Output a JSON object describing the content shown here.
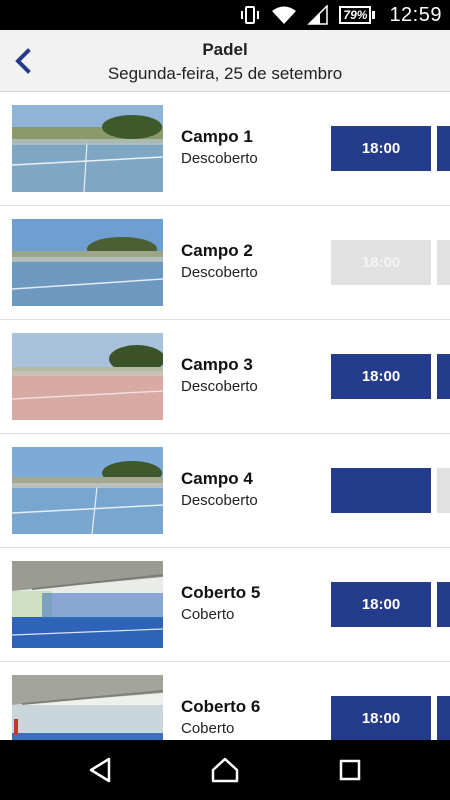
{
  "status_bar": {
    "battery": "79%",
    "time": "12:59",
    "icons": [
      "vibrate-icon",
      "wifi-icon",
      "signal-icon",
      "battery-icon"
    ]
  },
  "header": {
    "title": "Padel",
    "subtitle": "Segunda-feira, 25 de setembro"
  },
  "courts": [
    {
      "name": "Campo 1",
      "type": "Descoberto",
      "slots": [
        {
          "label": "18:00",
          "available": true
        },
        {
          "label": "",
          "available": true
        }
      ]
    },
    {
      "name": "Campo 2",
      "type": "Descoberto",
      "slots": [
        {
          "label": "18:00",
          "available": false
        },
        {
          "label": "",
          "available": false
        }
      ]
    },
    {
      "name": "Campo 3",
      "type": "Descoberto",
      "slots": [
        {
          "label": "18:00",
          "available": true
        },
        {
          "label": "",
          "available": true
        }
      ]
    },
    {
      "name": "Campo 4",
      "type": "Descoberto",
      "slots": [
        {
          "label": "",
          "available": true
        },
        {
          "label": "",
          "available": false
        }
      ]
    },
    {
      "name": "Coberto 5",
      "type": "Coberto",
      "slots": [
        {
          "label": "18:00",
          "available": true
        },
        {
          "label": "",
          "available": true
        }
      ]
    },
    {
      "name": "Coberto 6",
      "type": "Coberto",
      "slots": [
        {
          "label": "18:00",
          "available": true
        },
        {
          "label": "",
          "available": true
        }
      ]
    }
  ],
  "colors": {
    "accent": "#253b8c",
    "slot_disabled": "#e1e1e1",
    "header_bg": "#f2f2f2"
  },
  "nav_bar": {
    "icons": [
      "nav-back-icon",
      "nav-home-icon",
      "nav-recent-icon"
    ]
  }
}
